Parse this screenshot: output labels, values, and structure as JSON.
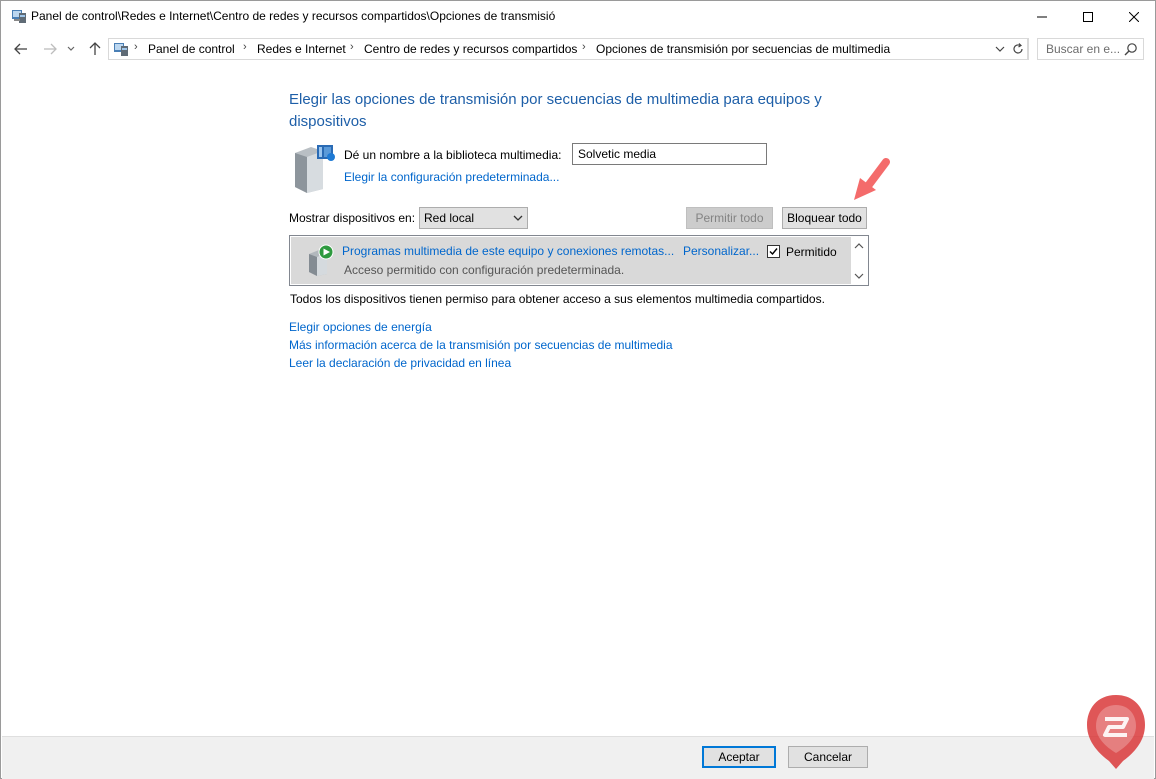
{
  "window": {
    "title": "Panel de control\\Redes e Internet\\Centro de redes y recursos compartidos\\Opciones de transmisió",
    "title_icon": "control-panel-icon"
  },
  "address_bar": {
    "breadcrumbs": [
      "Panel de control",
      "Redes e Internet",
      "Centro de redes y recursos compartidos",
      "Opciones de transmisión por secuencias de multimedia"
    ],
    "search_placeholder": "Buscar en e..."
  },
  "main": {
    "heading": "Elegir las opciones de transmisión por secuencias de multimedia para equipos y dispositivos",
    "library_label": "Dé un nombre a la biblioteca multimedia:",
    "library_name": "Solvetic media",
    "default_settings_link": "Elegir la configuración predeterminada...",
    "show_devices_label": "Mostrar dispositivos en:",
    "show_devices_value": "Red local",
    "permit_all": "Permitir todo",
    "block_all": "Bloquear todo",
    "devices": [
      {
        "name": "Programas multimedia de este equipo y conexiones remotas...",
        "customize": "Personalizar...",
        "description": "Acceso permitido con configuración predeterminada.",
        "checkbox_label": "Permitido",
        "checked": true
      }
    ],
    "all_allowed_text": "Todos los dispositivos tienen permiso para obtener acceso a sus elementos multimedia compartidos.",
    "links": [
      "Elegir opciones de energía",
      "Más información acerca de la transmisión por secuencias de multimedia",
      "Leer la declaración de privacidad en línea"
    ]
  },
  "footer": {
    "ok": "Aceptar",
    "cancel": "Cancelar"
  },
  "colors": {
    "heading": "#1e5fa8",
    "link": "#0066cc",
    "annotation_arrow": "#f46b6b",
    "logo": "#d9383a"
  }
}
